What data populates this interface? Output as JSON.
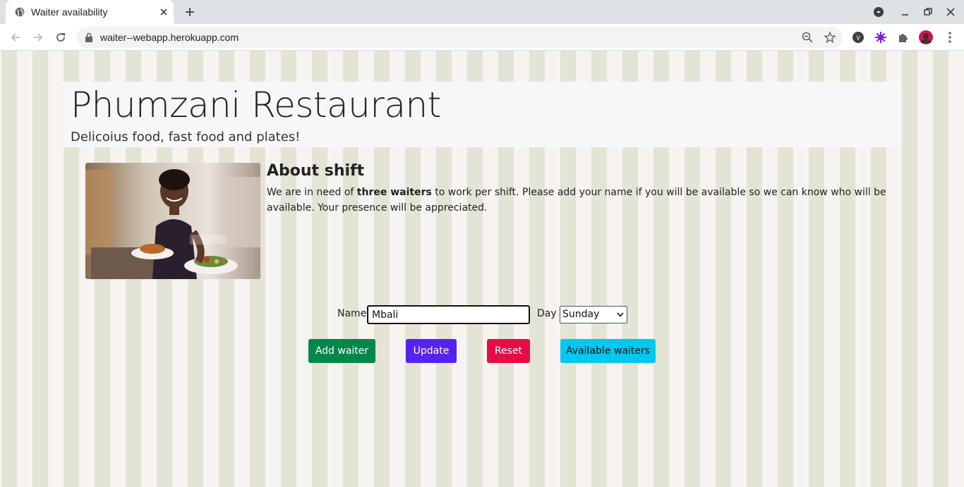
{
  "browser": {
    "tab_title": "Waiter availability",
    "url": "waiter--webapp.herokuapp.com"
  },
  "header": {
    "title": "Phumzani Restaurant",
    "subtitle": "Delicoius food, fast food and plates!"
  },
  "about": {
    "heading": "About shift",
    "text_before": "We are in need of ",
    "text_bold": "three waiters",
    "text_after": " to work per shift. Please add your name if you will be available so we can know who will be available. Your presence will be appreciated."
  },
  "form": {
    "name_label": "Name",
    "name_value": "Mbali",
    "day_label": "Day",
    "day_value": "Sunday"
  },
  "buttons": {
    "add": "Add waiter",
    "update": "Update",
    "reset": "Reset",
    "available": "Available waiters"
  },
  "colors": {
    "add": "#00884a",
    "update": "#5523f0",
    "reset": "#e60b46",
    "available": "#00c8ef"
  }
}
